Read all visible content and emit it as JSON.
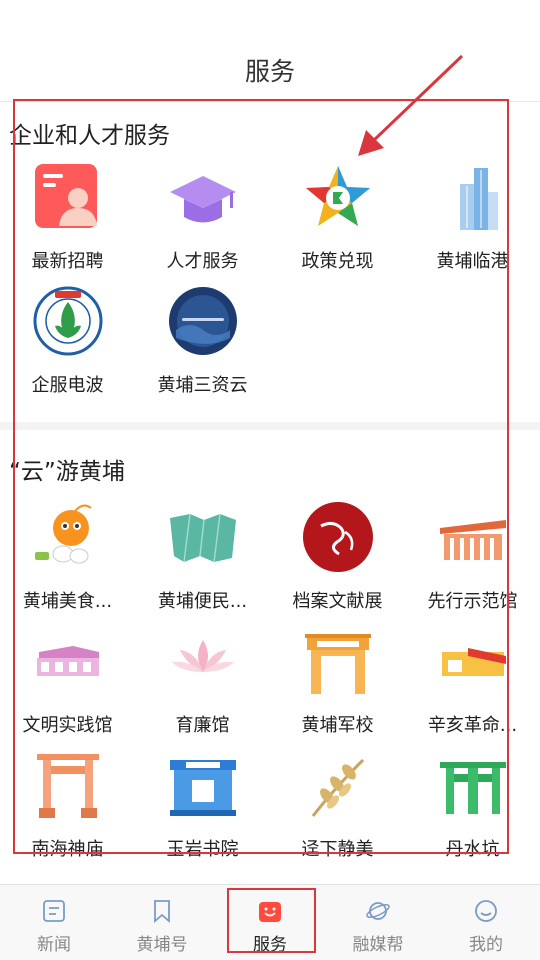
{
  "header": {
    "title": "服务"
  },
  "sections": [
    {
      "title": "企业和人才服务",
      "items": [
        {
          "label": "最新招聘",
          "icon": "recruitment-icon"
        },
        {
          "label": "人才服务",
          "icon": "graduation-cap-icon"
        },
        {
          "label": "政策兑现",
          "icon": "policy-star-icon"
        },
        {
          "label": "黄埔临港",
          "icon": "skyscraper-icon"
        },
        {
          "label": "企服电波",
          "icon": "mumian-badge-icon"
        },
        {
          "label": "黄埔三资云",
          "icon": "three-assets-cloud-icon"
        }
      ]
    },
    {
      "title": "“云”游黄埔",
      "items": [
        {
          "label": "黄埔美食...",
          "icon": "food-mascot-icon"
        },
        {
          "label": "黄埔便民...",
          "icon": "map-icon"
        },
        {
          "label": "档案文献展",
          "icon": "archive-dream-icon"
        },
        {
          "label": "先行示范馆",
          "icon": "pavilion-icon"
        },
        {
          "label": "文明实践馆",
          "icon": "practice-hall-icon"
        },
        {
          "label": "育廉馆",
          "icon": "lotus-icon"
        },
        {
          "label": "黄埔军校",
          "icon": "military-academy-gate-icon"
        },
        {
          "label": "辛亥革命...",
          "icon": "revolution-memorial-icon"
        },
        {
          "label": "南海神庙",
          "icon": "temple-arch-icon"
        },
        {
          "label": "玉岩书院",
          "icon": "academy-building-icon"
        },
        {
          "label": "迳下静美",
          "icon": "rice-stalk-icon"
        },
        {
          "label": "丹水坑",
          "icon": "green-archway-icon"
        }
      ]
    }
  ],
  "bottom_nav": [
    {
      "label": "新闻",
      "icon": "news-icon"
    },
    {
      "label": "黄埔号",
      "icon": "bookmark-icon"
    },
    {
      "label": "服务",
      "icon": "service-smile-icon",
      "active": true
    },
    {
      "label": "融媒帮",
      "icon": "planet-icon"
    },
    {
      "label": "我的",
      "icon": "profile-icon"
    }
  ],
  "colors": {
    "accent": "#ff4a3d",
    "highlight": "#d9363e"
  }
}
